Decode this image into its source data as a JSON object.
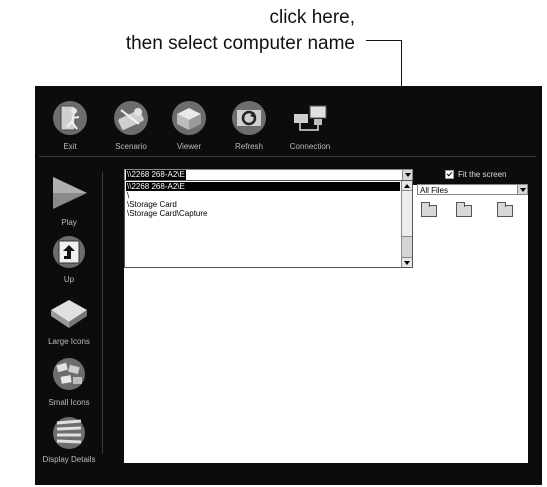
{
  "annotation": {
    "line1": "click here,",
    "line2": "then select computer name"
  },
  "toolbar": {
    "items": [
      {
        "label": "Exit",
        "icon": "exit-icon"
      },
      {
        "label": "Scenario",
        "icon": "scenario-icon"
      },
      {
        "label": "Viewer",
        "icon": "viewer-icon"
      },
      {
        "label": "Refresh",
        "icon": "refresh-icon"
      },
      {
        "label": "Connection",
        "icon": "connection-icon"
      }
    ]
  },
  "sidebar": {
    "items": [
      {
        "label": "Play",
        "icon": "play-icon"
      },
      {
        "label": "Up",
        "icon": "up-folder-icon"
      },
      {
        "label": "Large Icons",
        "icon": "large-icons-icon"
      },
      {
        "label": "Small Icons",
        "icon": "small-icons-icon"
      },
      {
        "label": "Display Details",
        "icon": "display-details-icon"
      }
    ]
  },
  "path_combo": {
    "value": "\\\\2268 268-A2\\E",
    "options": [
      "\\\\2268 268-A2\\E",
      "\\",
      "\\Storage Card",
      "\\Storage Card\\Capture"
    ],
    "selected_index": 0
  },
  "fit_screen": {
    "label": "Fit the screen",
    "checked": true
  },
  "file_filter": {
    "value": "All Files"
  },
  "folders": {
    "count": 3
  }
}
